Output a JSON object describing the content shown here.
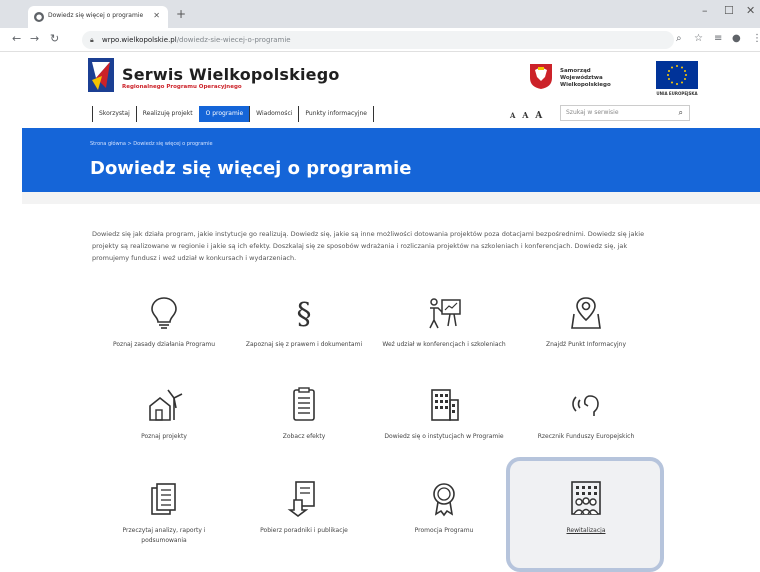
{
  "browser": {
    "tab_title": "Dowiedz się więcej o programie",
    "url_host": "wrpo.wielkopolskie.pl",
    "url_path": "/dowiedz-sie-wiecej-o-programie"
  },
  "header": {
    "site_title": "Serwis Wielkopolskiego",
    "site_subtitle": "Regionalnego Programu Operacyjnego",
    "region_label": "Samorząd Województwa Wielkopolskiego",
    "eu_label": "UNIA EUROPEJSKA",
    "font_sizes": [
      "A",
      "A",
      "A"
    ],
    "search_placeholder": "Szukaj w serwisie"
  },
  "nav": {
    "items": [
      {
        "label": "Skorzystaj"
      },
      {
        "label": "Realizuję projekt"
      },
      {
        "label": "O programie"
      },
      {
        "label": "Wiadomości"
      },
      {
        "label": "Punkty informacyjne"
      }
    ],
    "active_index": 2
  },
  "banner": {
    "breadcrumb": "Strona główna  >  Dowiedz się więcej o programie",
    "title": "Dowiedz się więcej o programie"
  },
  "intro": "Dowiedz się jak działa program, jakie instytucje go realizują. Dowiedz się, jakie są inne możliwości dotowania projektów poza dotacjami bezpośrednimi. Dowiedz się jakie projekty są realizowane w regionie i jakie są ich efekty. Doszkalaj się ze sposobów wdrażania i rozliczania projektów na szkoleniach i konferencjach. Dowiedz się, jak promujemy fundusz i weź udział w konkursach i wydarzeniach.",
  "tiles": [
    {
      "label": "Poznaj zasady działania Programu",
      "icon": "lightbulb-icon"
    },
    {
      "label": "Zapoznaj się z prawem i dokumentami",
      "icon": "paragraph-icon"
    },
    {
      "label": "Weź udział w konferencjach i szkoleniach",
      "icon": "presentation-icon"
    },
    {
      "label": "Znajdź Punkt Informacyjny",
      "icon": "location-pin-icon"
    },
    {
      "label": "Poznaj projekty",
      "icon": "house-windmill-icon"
    },
    {
      "label": "Zobacz efekty",
      "icon": "checklist-icon"
    },
    {
      "label": "Dowiedz się o instytucjach w Programie",
      "icon": "building-icon"
    },
    {
      "label": "Rzecznik Funduszy Europejskich",
      "icon": "speaker-icon"
    },
    {
      "label": "Przeczytaj analizy, raporty i podsumowania",
      "icon": "documents-icon"
    },
    {
      "label": "Pobierz poradniki i publikacje",
      "icon": "download-document-icon"
    },
    {
      "label": "Promocja Programu",
      "icon": "award-icon"
    },
    {
      "label": "Rewitalizacja",
      "icon": "people-building-icon"
    }
  ],
  "colors": {
    "primary": "#1565d8",
    "highlight_frame": "#b6c4dc",
    "logo_red": "#cc2229"
  }
}
